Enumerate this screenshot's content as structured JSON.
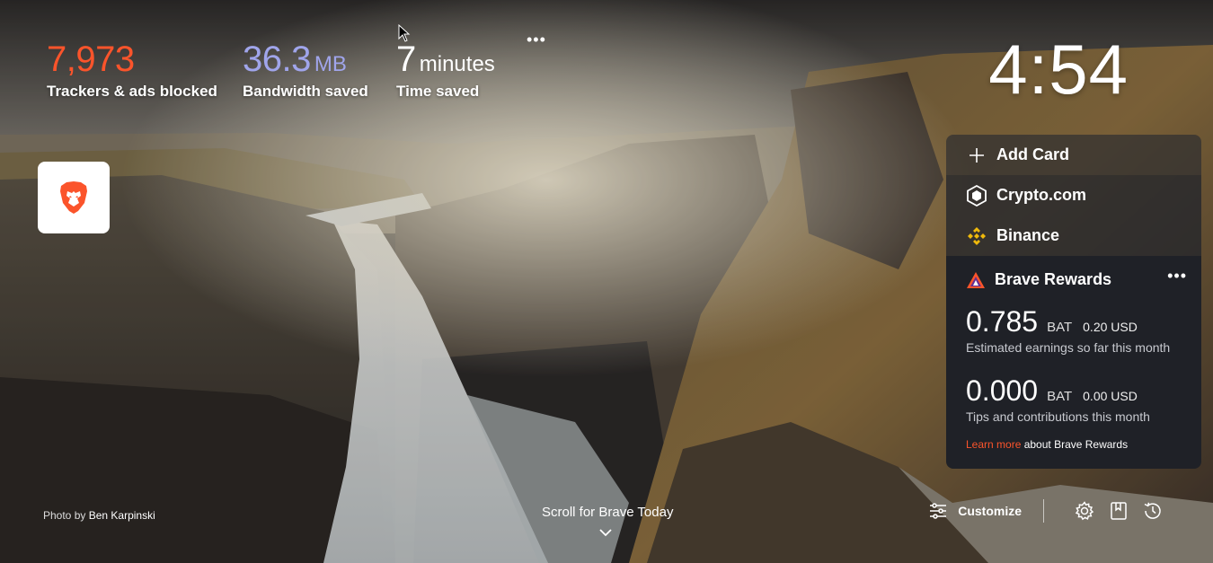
{
  "stats": {
    "trackers": {
      "value": "7,973",
      "label": "Trackers & ads blocked"
    },
    "bandwidth": {
      "value": "36.3",
      "unit": "MB",
      "label": "Bandwidth saved"
    },
    "time": {
      "value": "7",
      "unit": "minutes",
      "label": "Time saved"
    },
    "menu": "•••"
  },
  "clock": "4:54",
  "cards": {
    "add_card": "Add Card",
    "crypto": "Crypto.com",
    "binance": "Binance"
  },
  "rewards": {
    "title": "Brave Rewards",
    "menu": "•••",
    "earnings": {
      "value": "0.785",
      "unit": "BAT",
      "usd": "0.20 USD",
      "desc": "Estimated earnings so far this month"
    },
    "tips": {
      "value": "0.000",
      "unit": "BAT",
      "usd": "0.00 USD",
      "desc": "Tips and contributions this month"
    },
    "learn_link": "Learn more",
    "learn_suffix": " about Brave Rewards"
  },
  "footer": {
    "credit_prefix": "Photo by ",
    "credit_name": "Ben Karpinski",
    "scroll_hint": "Scroll for Brave Today",
    "customize": "Customize"
  },
  "colors": {
    "trackers": "#fb542b",
    "bandwidth": "#a0a5eb",
    "link": "#fb542b"
  },
  "icons": [
    "brave-lion-icon",
    "plus-icon",
    "crypto-com-icon",
    "binance-icon",
    "brave-rewards-icon",
    "customize-sliders-icon",
    "gear-icon",
    "bookmark-icon",
    "history-icon",
    "chevron-down-icon"
  ]
}
